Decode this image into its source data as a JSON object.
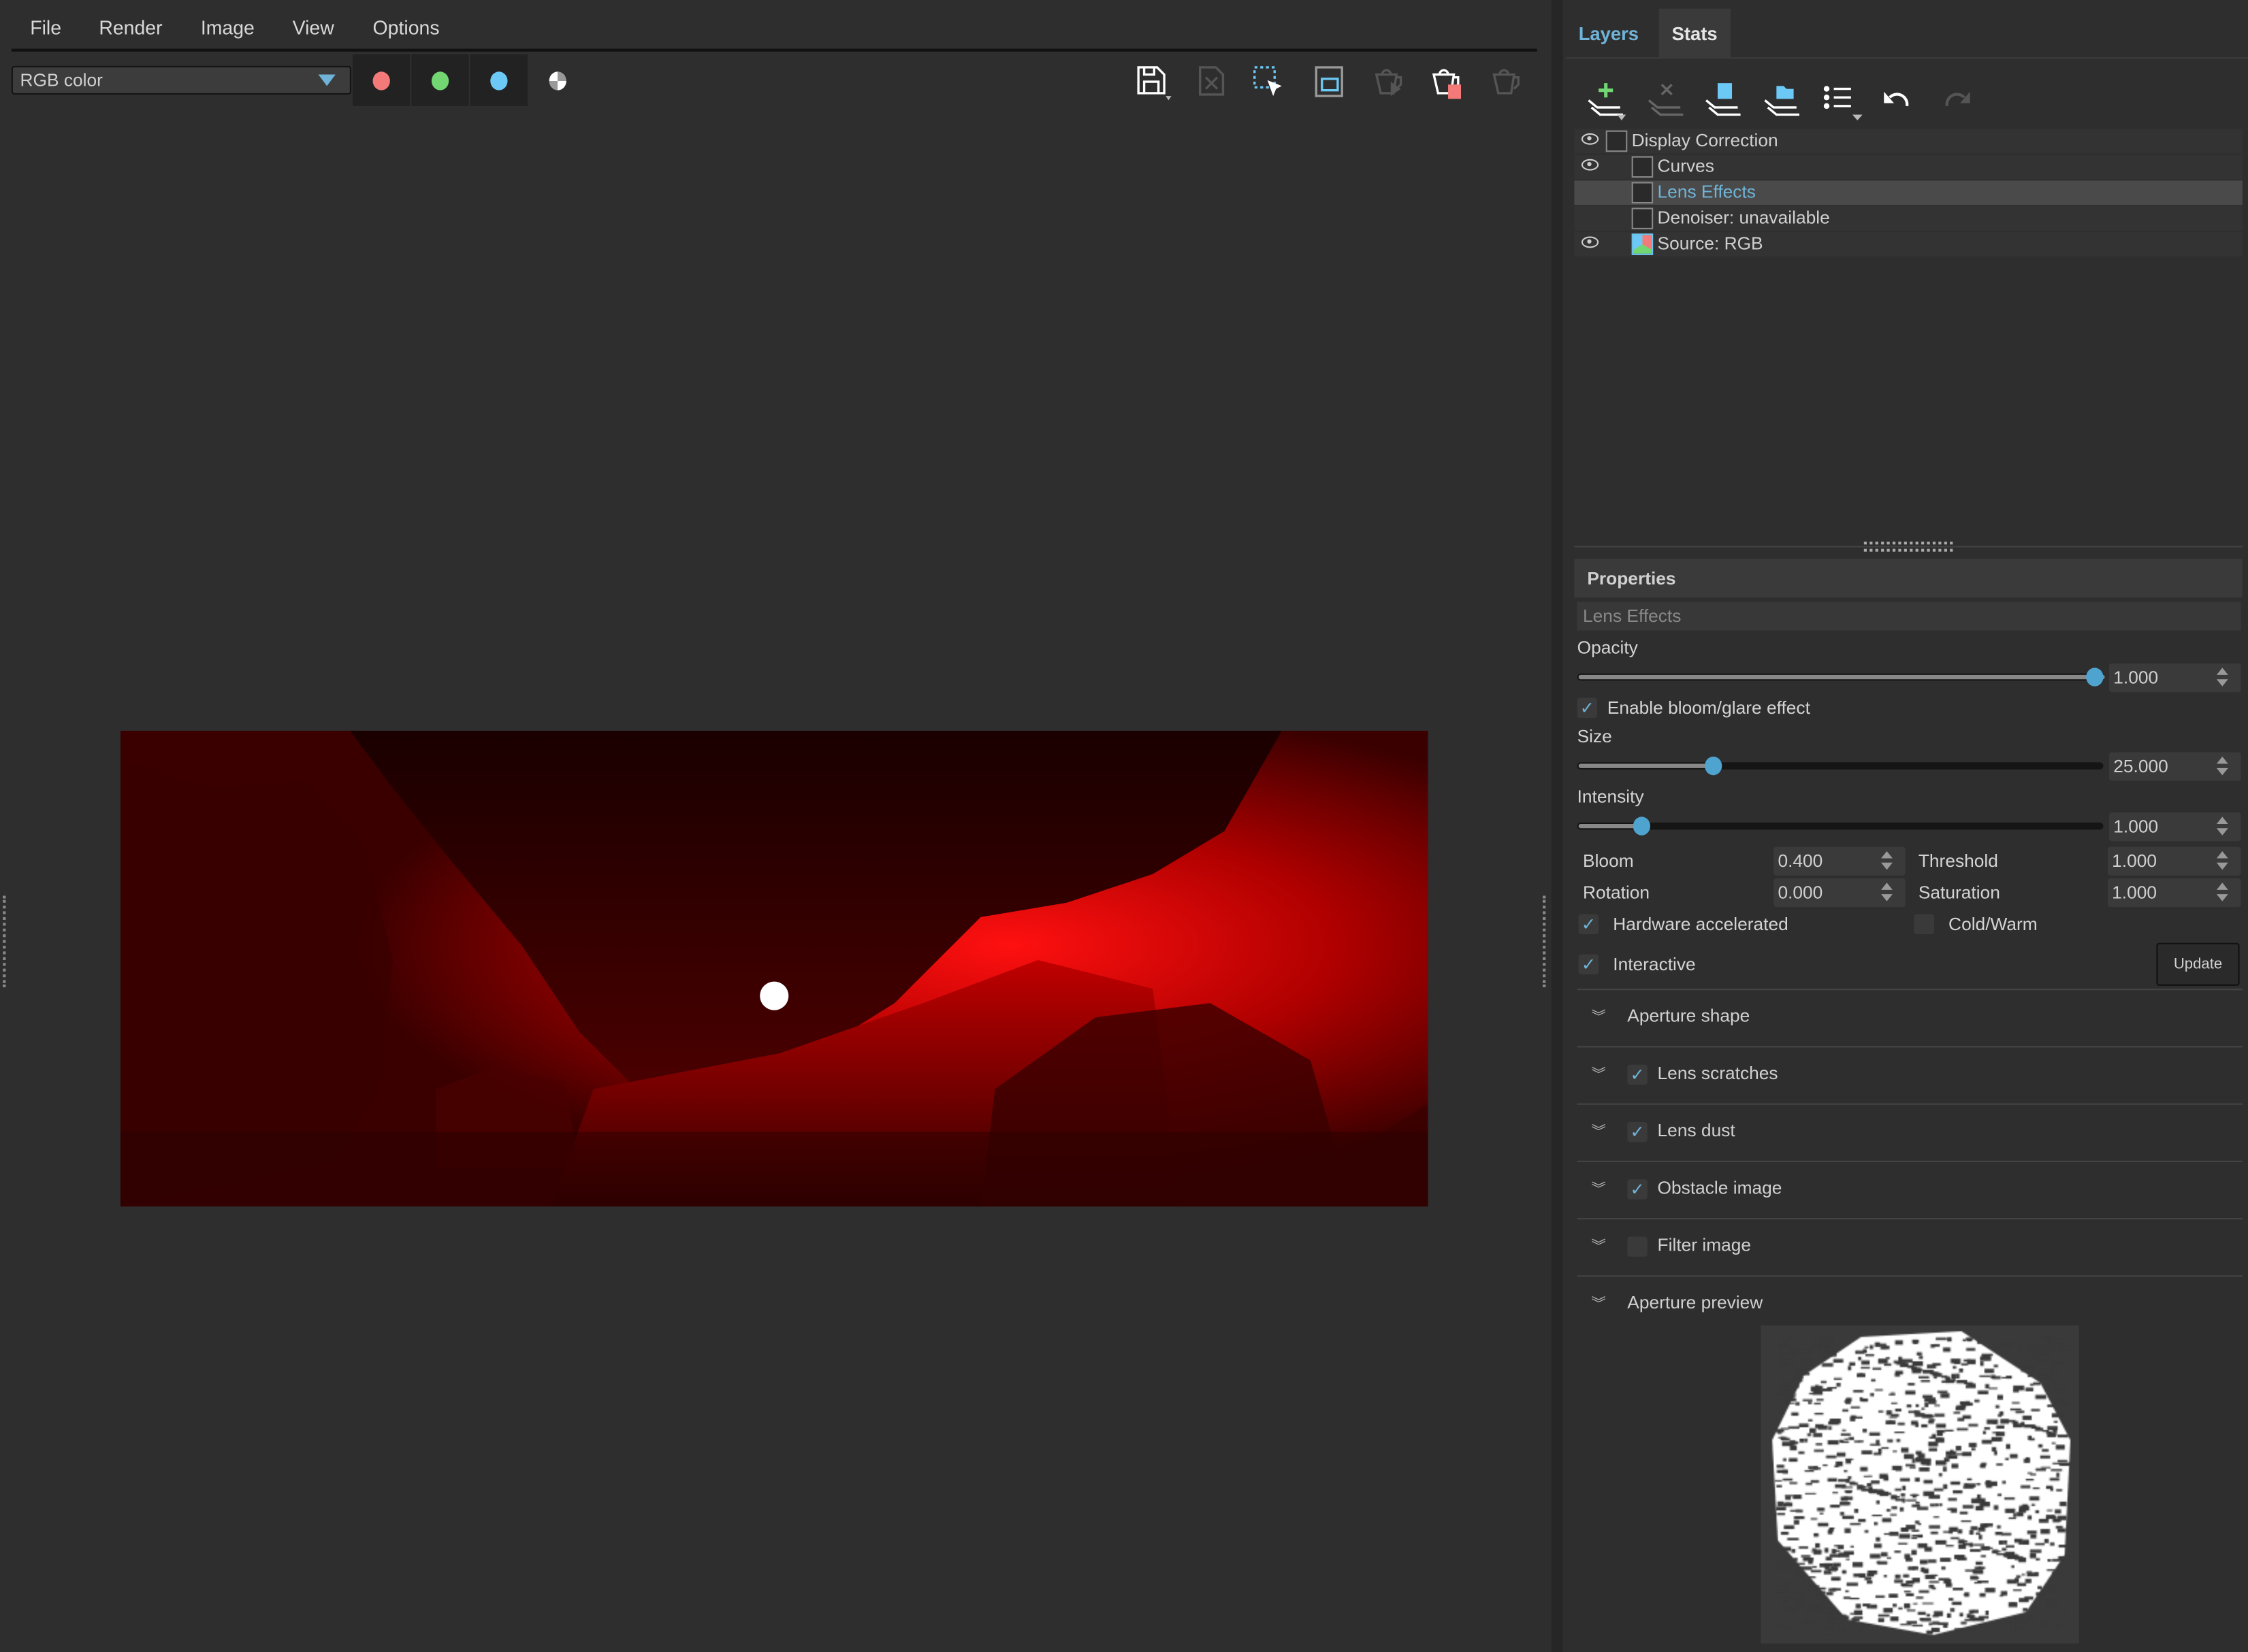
{
  "menu": [
    "File",
    "Render",
    "Image",
    "View",
    "Options"
  ],
  "channel_select": {
    "value": "RGB color"
  },
  "channels": [
    {
      "name": "red",
      "color": "#f47a7a"
    },
    {
      "name": "green",
      "color": "#72d672"
    },
    {
      "name": "blue",
      "color": "#6cc8f5"
    }
  ],
  "toolbar_icons": [
    "save-icon",
    "close-file-icon",
    "select-region-icon",
    "crop-region-icon",
    "render-start-icon",
    "render-stop-icon",
    "render-pause-icon"
  ],
  "tabs": [
    {
      "label": "Layers",
      "active": true
    },
    {
      "label": "Stats",
      "active": false
    }
  ],
  "layer_toolbar_icons": [
    "add-layer-icon",
    "remove-layer-icon",
    "save-layers-icon",
    "open-layers-icon",
    "layer-list-icon",
    "undo-icon",
    "redo-icon"
  ],
  "layers": [
    {
      "label": "Display Correction",
      "visible": true,
      "selected": false,
      "indent": 0
    },
    {
      "label": "Curves",
      "visible": true,
      "selected": false,
      "indent": 1
    },
    {
      "label": "Lens Effects",
      "visible": false,
      "selected": true,
      "indent": 1
    },
    {
      "label": "Denoiser: unavailable",
      "visible": false,
      "selected": false,
      "indent": 1
    },
    {
      "label": "Source: RGB",
      "visible": true,
      "selected": false,
      "indent": 1
    }
  ],
  "properties": {
    "title": "Properties",
    "layer_name": "Lens Effects",
    "opacity": {
      "label": "Opacity",
      "value": "1.000",
      "fraction": 1.0
    },
    "enable_bloom": {
      "label": "Enable bloom/glare effect",
      "checked": true
    },
    "size": {
      "label": "Size",
      "value": "25.000",
      "fraction": 0.25
    },
    "intensity": {
      "label": "Intensity",
      "value": "1.000",
      "fraction": 0.11
    },
    "bloom": {
      "label": "Bloom",
      "value": "0.400"
    },
    "threshold": {
      "label": "Threshold",
      "value": "1.000"
    },
    "rotation": {
      "label": "Rotation",
      "value": "0.000"
    },
    "saturation": {
      "label": "Saturation",
      "value": "1.000"
    },
    "hardware": {
      "label": "Hardware accelerated",
      "checked": true
    },
    "coldwarm": {
      "label": "Cold/Warm",
      "checked": false
    },
    "interactive": {
      "label": "Interactive",
      "checked": true
    },
    "update_label": "Update",
    "sections": [
      {
        "label": "Aperture shape",
        "has_checkbox": false
      },
      {
        "label": "Lens scratches",
        "has_checkbox": true,
        "checked": true
      },
      {
        "label": "Lens dust",
        "has_checkbox": true,
        "checked": true
      },
      {
        "label": "Obstacle image",
        "has_checkbox": true,
        "checked": true
      },
      {
        "label": "Filter image",
        "has_checkbox": true,
        "checked": false
      },
      {
        "label": "Aperture preview",
        "has_checkbox": false
      }
    ]
  },
  "colors": {
    "accent": "#6fb4d8",
    "background": "#2e2e2e"
  }
}
